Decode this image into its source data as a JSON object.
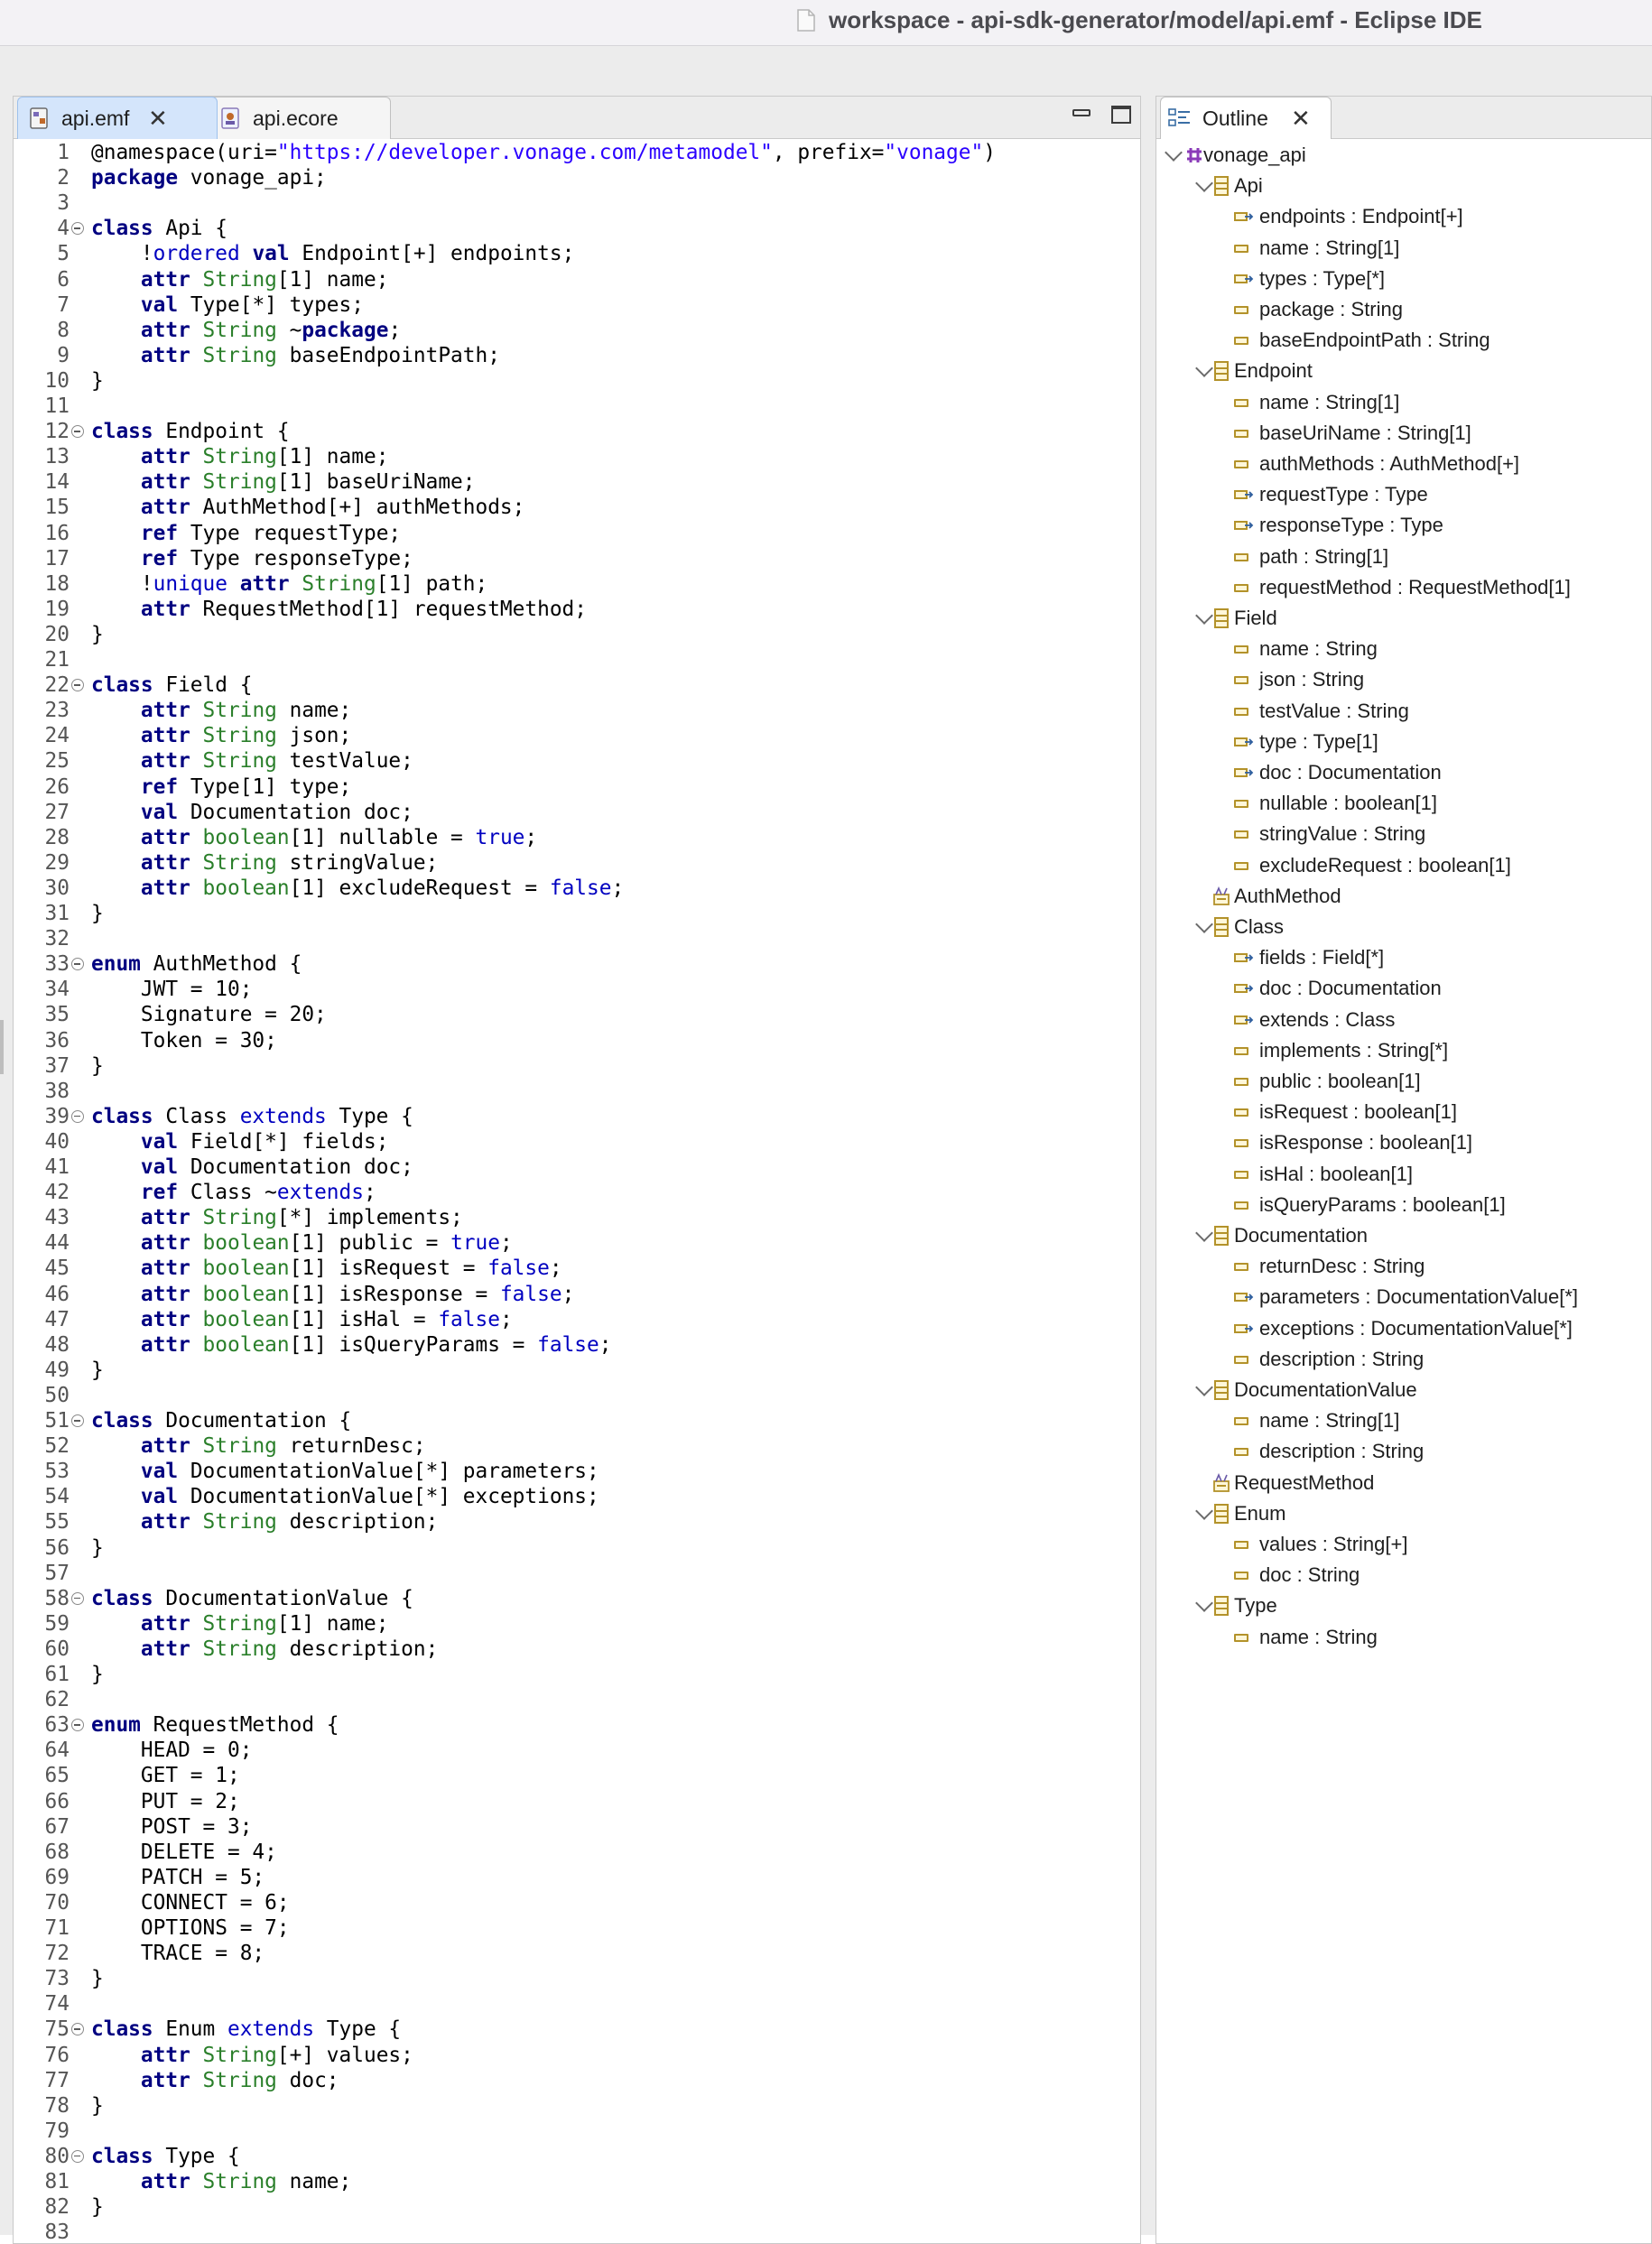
{
  "window": {
    "title": "workspace - api-sdk-generator/model/api.emf - Eclipse IDE",
    "title_icon": "document-icon"
  },
  "editor": {
    "tabs": [
      {
        "label": "api.emf",
        "active": true,
        "icon": "emf-file-icon"
      },
      {
        "label": "api.ecore",
        "active": false,
        "icon": "ecore-file-icon"
      }
    ],
    "lines": [
      "@namespace(uri=\"https://developer.vonage.com/metamodel\", prefix=\"vonage\")",
      "package vonage_api;",
      "",
      "class Api {",
      "    !ordered val Endpoint[+] endpoints;",
      "    attr String[1] name;",
      "    val Type[*] types;",
      "    attr String ~package;",
      "    attr String baseEndpointPath;",
      "}",
      "",
      "class Endpoint {",
      "    attr String[1] name;",
      "    attr String[1] baseUriName;",
      "    attr AuthMethod[+] authMethods;",
      "    ref Type requestType;",
      "    ref Type responseType;",
      "    !unique attr String[1] path;",
      "    attr RequestMethod[1] requestMethod;",
      "}",
      "",
      "class Field {",
      "    attr String name;",
      "    attr String json;",
      "    attr String testValue;",
      "    ref Type[1] type;",
      "    val Documentation doc;",
      "    attr boolean[1] nullable = true;",
      "    attr String stringValue;",
      "    attr boolean[1] excludeRequest = false;",
      "}",
      "",
      "enum AuthMethod {",
      "    JWT = 10;",
      "    Signature = 20;",
      "    Token = 30;",
      "}",
      "",
      "class Class extends Type {",
      "    val Field[*] fields;",
      "    val Documentation doc;",
      "    ref Class ~extends;",
      "    attr String[*] implements;",
      "    attr boolean[1] public = true;",
      "    attr boolean[1] isRequest = false;",
      "    attr boolean[1] isResponse = false;",
      "    attr boolean[1] isHal = false;",
      "    attr boolean[1] isQueryParams = false;",
      "}",
      "",
      "class Documentation {",
      "    attr String returnDesc;",
      "    val DocumentationValue[*] parameters;",
      "    val DocumentationValue[*] exceptions;",
      "    attr String description;",
      "}",
      "",
      "class DocumentationValue {",
      "    attr String[1] name;",
      "    attr String description;",
      "}",
      "",
      "enum RequestMethod {",
      "    HEAD = 0;",
      "    GET = 1;",
      "    PUT = 2;",
      "    POST = 3;",
      "    DELETE = 4;",
      "    PATCH = 5;",
      "    CONNECT = 6;",
      "    OPTIONS = 7;",
      "    TRACE = 8;",
      "}",
      "",
      "class Enum extends Type {",
      "    attr String[+] values;",
      "    attr String doc;",
      "}",
      "",
      "class Type {",
      "    attr String name;",
      "}",
      ""
    ],
    "fold_lines": [
      4,
      12,
      22,
      33,
      39,
      51,
      58,
      63,
      75,
      80
    ]
  },
  "outline": {
    "tab_label": "Outline",
    "items": [
      {
        "label": "vonage_api",
        "level": 0,
        "icon": "package-icon",
        "expanded": true
      },
      {
        "label": "Api",
        "level": 1,
        "icon": "class-icon",
        "expanded": true
      },
      {
        "label": "endpoints : Endpoint[+]",
        "level": 2,
        "icon": "reference-icon"
      },
      {
        "label": "name : String[1]",
        "level": 2,
        "icon": "attribute-icon"
      },
      {
        "label": "types : Type[*]",
        "level": 2,
        "icon": "reference-icon"
      },
      {
        "label": "package : String",
        "level": 2,
        "icon": "attribute-icon"
      },
      {
        "label": "baseEndpointPath : String",
        "level": 2,
        "icon": "attribute-icon"
      },
      {
        "label": "Endpoint",
        "level": 1,
        "icon": "class-icon",
        "expanded": true
      },
      {
        "label": "name : String[1]",
        "level": 2,
        "icon": "attribute-icon"
      },
      {
        "label": "baseUriName : String[1]",
        "level": 2,
        "icon": "attribute-icon"
      },
      {
        "label": "authMethods : AuthMethod[+]",
        "level": 2,
        "icon": "attribute-icon"
      },
      {
        "label": "requestType : Type",
        "level": 2,
        "icon": "reference-icon"
      },
      {
        "label": "responseType : Type",
        "level": 2,
        "icon": "reference-icon"
      },
      {
        "label": "path : String[1]",
        "level": 2,
        "icon": "attribute-icon"
      },
      {
        "label": "requestMethod : RequestMethod[1]",
        "level": 2,
        "icon": "attribute-icon"
      },
      {
        "label": "Field",
        "level": 1,
        "icon": "class-icon",
        "expanded": true
      },
      {
        "label": "name : String",
        "level": 2,
        "icon": "attribute-icon"
      },
      {
        "label": "json : String",
        "level": 2,
        "icon": "attribute-icon"
      },
      {
        "label": "testValue : String",
        "level": 2,
        "icon": "attribute-icon"
      },
      {
        "label": "type : Type[1]",
        "level": 2,
        "icon": "reference-icon"
      },
      {
        "label": "doc : Documentation",
        "level": 2,
        "icon": "reference-icon"
      },
      {
        "label": "nullable : boolean[1]",
        "level": 2,
        "icon": "attribute-icon"
      },
      {
        "label": "stringValue : String",
        "level": 2,
        "icon": "attribute-icon"
      },
      {
        "label": "excludeRequest : boolean[1]",
        "level": 2,
        "icon": "attribute-icon"
      },
      {
        "label": "AuthMethod",
        "level": 1,
        "icon": "enum-icon"
      },
      {
        "label": "Class",
        "level": 1,
        "icon": "class-icon",
        "expanded": true
      },
      {
        "label": "fields : Field[*]",
        "level": 2,
        "icon": "reference-icon"
      },
      {
        "label": "doc : Documentation",
        "level": 2,
        "icon": "reference-icon"
      },
      {
        "label": "extends : Class",
        "level": 2,
        "icon": "reference-icon"
      },
      {
        "label": "implements : String[*]",
        "level": 2,
        "icon": "attribute-icon"
      },
      {
        "label": "public : boolean[1]",
        "level": 2,
        "icon": "attribute-icon"
      },
      {
        "label": "isRequest : boolean[1]",
        "level": 2,
        "icon": "attribute-icon"
      },
      {
        "label": "isResponse : boolean[1]",
        "level": 2,
        "icon": "attribute-icon"
      },
      {
        "label": "isHal : boolean[1]",
        "level": 2,
        "icon": "attribute-icon"
      },
      {
        "label": "isQueryParams : boolean[1]",
        "level": 2,
        "icon": "attribute-icon"
      },
      {
        "label": "Documentation",
        "level": 1,
        "icon": "class-icon",
        "expanded": true
      },
      {
        "label": "returnDesc : String",
        "level": 2,
        "icon": "attribute-icon"
      },
      {
        "label": "parameters : DocumentationValue[*]",
        "level": 2,
        "icon": "reference-icon"
      },
      {
        "label": "exceptions : DocumentationValue[*]",
        "level": 2,
        "icon": "reference-icon"
      },
      {
        "label": "description : String",
        "level": 2,
        "icon": "attribute-icon"
      },
      {
        "label": "DocumentationValue",
        "level": 1,
        "icon": "class-icon",
        "expanded": true
      },
      {
        "label": "name : String[1]",
        "level": 2,
        "icon": "attribute-icon"
      },
      {
        "label": "description : String",
        "level": 2,
        "icon": "attribute-icon"
      },
      {
        "label": "RequestMethod",
        "level": 1,
        "icon": "enum-icon"
      },
      {
        "label": "Enum",
        "level": 1,
        "icon": "class-icon",
        "expanded": true
      },
      {
        "label": "values : String[+]",
        "level": 2,
        "icon": "attribute-icon"
      },
      {
        "label": "doc : String",
        "level": 2,
        "icon": "attribute-icon"
      },
      {
        "label": "Type",
        "level": 1,
        "icon": "class-icon",
        "expanded": true
      },
      {
        "label": "name : String",
        "level": 2,
        "icon": "attribute-icon"
      }
    ]
  },
  "colors": {
    "keyword": "#7f0055",
    "type": "#2a7f2a",
    "literal": "#0000c0",
    "string": "#2a00ff",
    "active_tab": "#d4e5fb"
  }
}
